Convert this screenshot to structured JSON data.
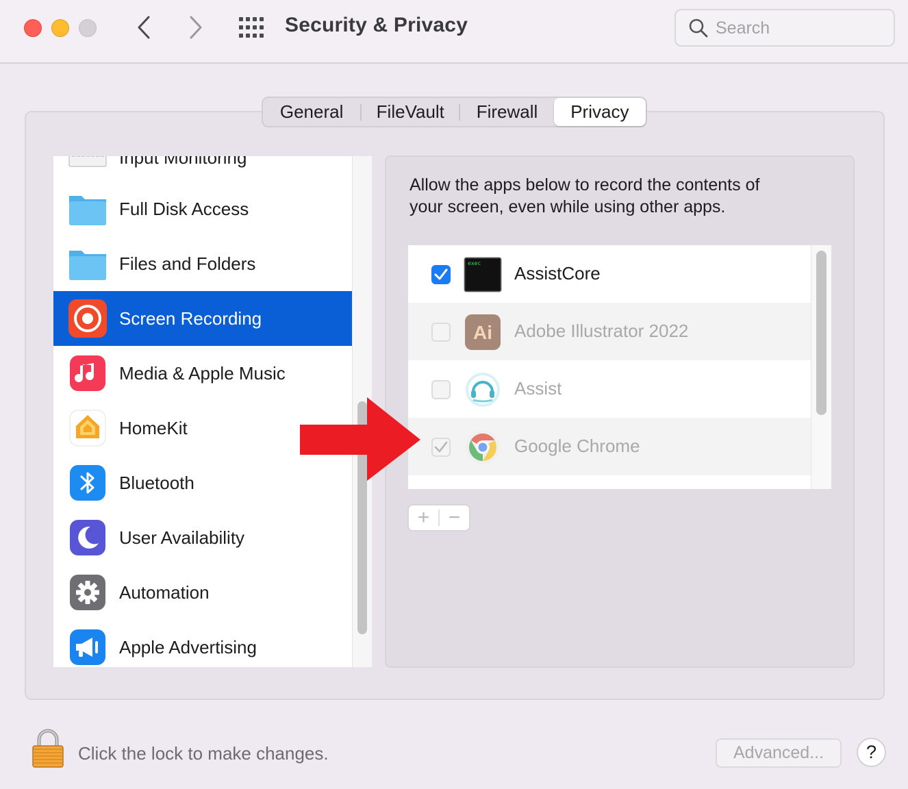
{
  "window": {
    "title": "Security & Privacy",
    "search_placeholder": "Search"
  },
  "tabs": [
    {
      "label": "General",
      "selected": false
    },
    {
      "label": "FileVault",
      "selected": false
    },
    {
      "label": "Firewall",
      "selected": false
    },
    {
      "label": "Privacy",
      "selected": true
    }
  ],
  "sidebar": {
    "items": [
      {
        "label": "Input Monitoring",
        "icon": "keyboard-icon"
      },
      {
        "label": "Full Disk Access",
        "icon": "folder-icon"
      },
      {
        "label": "Files and Folders",
        "icon": "folder-icon"
      },
      {
        "label": "Screen Recording",
        "icon": "screen-recording-icon",
        "selected": true
      },
      {
        "label": "Media & Apple Music",
        "icon": "music-icon"
      },
      {
        "label": "HomeKit",
        "icon": "homekit-icon"
      },
      {
        "label": "Bluetooth",
        "icon": "bluetooth-icon"
      },
      {
        "label": "User Availability",
        "icon": "moon-icon"
      },
      {
        "label": "Automation",
        "icon": "gear-icon"
      },
      {
        "label": "Apple Advertising",
        "icon": "megaphone-icon"
      }
    ]
  },
  "pane": {
    "description_line1": "Allow the apps below to record the contents of",
    "description_line2": "your screen, even while using other apps.",
    "apps": [
      {
        "name": "AssistCore",
        "checked": true,
        "enabled": true,
        "icon_text": "exec"
      },
      {
        "name": "Adobe Illustrator 2022",
        "checked": false,
        "enabled": false,
        "icon_text": "Ai"
      },
      {
        "name": "Assist",
        "checked": false,
        "enabled": false
      },
      {
        "name": "Google Chrome",
        "checked": true,
        "enabled": false
      }
    ],
    "add_label": "+",
    "remove_label": "−"
  },
  "footer": {
    "lock_text": "Click the lock to make changes.",
    "advanced_label": "Advanced...",
    "help_label": "?"
  },
  "colors": {
    "selection": "#0a5fd7",
    "checkbox_on": "#1a7cf5",
    "arrow": "#ec1c24"
  }
}
